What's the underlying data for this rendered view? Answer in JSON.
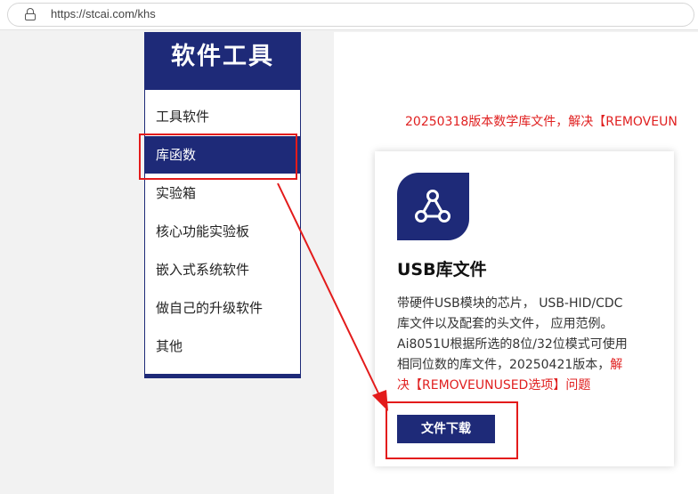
{
  "browser": {
    "url": "https://stcai.com/khs",
    "lock_icon": "lock-icon"
  },
  "sidebar": {
    "title": "软件工具",
    "items": [
      {
        "label": "工具软件",
        "active": false
      },
      {
        "label": "库函数",
        "active": true
      },
      {
        "label": "实验箱",
        "active": false
      },
      {
        "label": "核心功能实验板",
        "active": false
      },
      {
        "label": "嵌入式系统软件",
        "active": false
      },
      {
        "label": "做自己的升级软件",
        "active": false
      },
      {
        "label": "其他",
        "active": false
      }
    ]
  },
  "main": {
    "notice": "20250318版本数学库文件，解决【REMOVEUN",
    "card": {
      "icon": "share-nodes-icon",
      "title": "USB库文件",
      "desc_lines": [
        "带硬件USB模块的芯片， USB-HID/CDC",
        "库文件以及配套的头文件， 应用范例。",
        "Ai8051U根据所选的8位/32位模式可使用",
        "相同位数的库文件，20250421版本，",
        "解",
        "决【REMOVEUNUSED选项】问题"
      ],
      "download_label": "文件下载"
    }
  },
  "colors": {
    "brand": "#1e2a78",
    "alert": "#e02020",
    "annotation": "#e31b1b"
  }
}
